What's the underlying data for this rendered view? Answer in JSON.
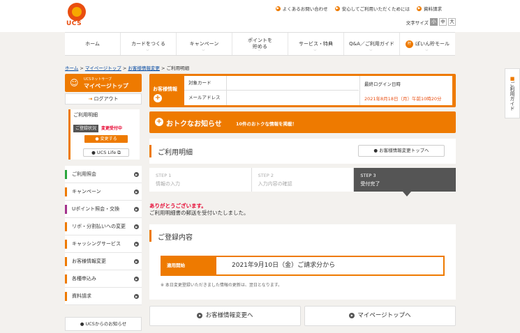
{
  "brand": {
    "logo_text": "UCS",
    "accent": "#ee7a00",
    "red": "#e6002d"
  },
  "toplinks": [
    "よくあるお問い合わせ",
    "安心してご利用いただくためには",
    "資料請求"
  ],
  "fontsize": {
    "label": "文字サイズ",
    "small": "小",
    "medium": "中",
    "large": "大"
  },
  "nav": {
    "items": [
      "ホーム",
      "カードをつくる",
      "キャンペーン",
      "ポイントを貯める",
      "サービス・特典",
      "Q&A／ご利用ガイド",
      "ぽいん貯モール"
    ],
    "mall_icon": "貯"
  },
  "breadcrumb": {
    "home": "ホーム",
    "mypage": "マイページトップ",
    "custinfo": "お客様情報変更",
    "current": "ご利用明細"
  },
  "sidebar": {
    "mypage_small": "UCSネットサーブ",
    "mypage_label": "マイページトップ",
    "logout": "ログアウト",
    "meisai_title": "ご利用明細",
    "status_label": "ご登録状況",
    "status_value": "変更受付中",
    "change_button": "変更する",
    "ucslife": "UCS Life",
    "menu": [
      {
        "label": "ご利用照会",
        "color": "#2aa63c"
      },
      {
        "label": "キャンペーン",
        "color": "#ee7a00"
      },
      {
        "label": "Uポイント照会・交換",
        "color": "#a4328c"
      },
      {
        "label": "リボ・分割払いへの変更",
        "color": "#ee7a00"
      },
      {
        "label": "キャッシングサービス",
        "color": "#ee7a00"
      },
      {
        "label": "お客様情報変更",
        "color": "#ee7a00"
      },
      {
        "label": "各種申込み",
        "color": "#ee7a00"
      },
      {
        "label": "資料請求",
        "color": "#ee7a00"
      }
    ],
    "ucs_news": "UCSからのお知らせ"
  },
  "custinfo": {
    "label": "お客様情報",
    "card_label": "対象カード",
    "mail_label": "メールアドレス",
    "login_label": "最終ログイン日時",
    "login_value": "2021年8月18日（月）午前10時20分"
  },
  "otoku": {
    "title": "おトクなお知らせ",
    "sub": "10件のおトクな情報を掲載！"
  },
  "main": {
    "title": "ご利用明細",
    "back_button": "お客様情報変更トップへ"
  },
  "steps": [
    {
      "num": "STEP 1",
      "label": "情報の入力"
    },
    {
      "num": "STEP 2",
      "label": "入力内容の確認"
    },
    {
      "num": "STEP 3",
      "label": "受付完了"
    }
  ],
  "thanks": {
    "title": "ありがとうございます。",
    "message": "ご利用明細書の郵送を受付いたしました。"
  },
  "registration": {
    "title": "ご登録内容",
    "key": "適用開始",
    "value": "2021年9月10日（金）ご請求分から",
    "note": "※ 本日変更登録いただきました情報の更新は、翌日となります。"
  },
  "buttons": {
    "custinfo": "お客様情報変更へ",
    "mypage": "マイページトップへ"
  },
  "guide": "ご利用ガイド"
}
